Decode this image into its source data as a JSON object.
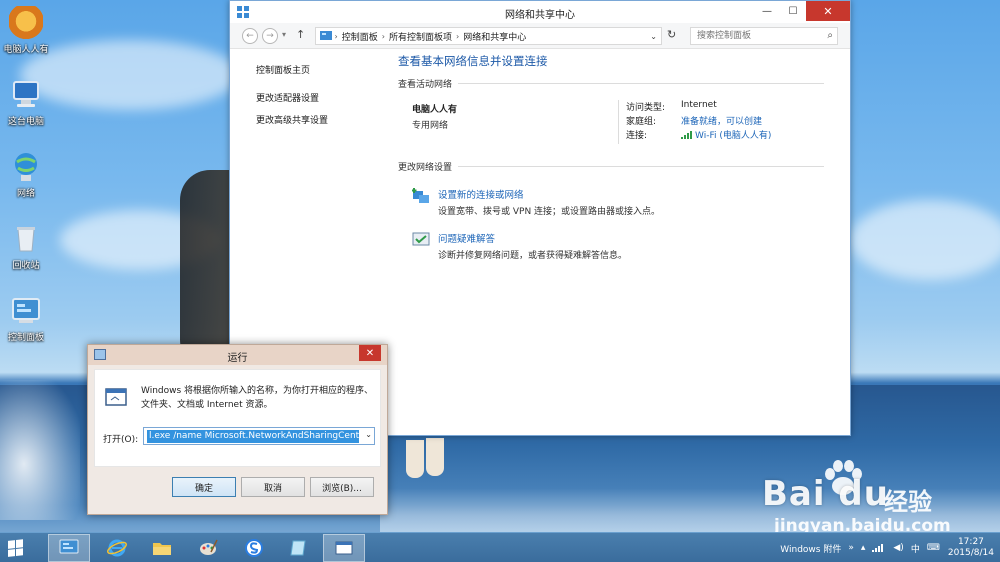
{
  "desktop": {
    "icons": [
      {
        "label": "电脑人人有"
      },
      {
        "label": "这台电脑"
      },
      {
        "label": "网络"
      },
      {
        "label": "回收站"
      },
      {
        "label": "控制面板"
      }
    ]
  },
  "watermark": {
    "brand": "Bai du",
    "brand_cn": "经验",
    "site": "jingyan.baidu.com"
  },
  "window": {
    "title": "网络和共享中心",
    "controls": {
      "minimize": "—",
      "maximize": "☐",
      "close": "✕"
    },
    "address": {
      "crumbs": [
        "控制面板",
        "所有控制面板项",
        "网络和共享中心"
      ]
    },
    "search": {
      "placeholder": "搜索控制面板"
    },
    "left_nav": [
      "控制面板主页",
      "更改适配器设置",
      "更改高级共享设置"
    ],
    "main": {
      "heading": "查看基本网络信息并设置连接",
      "active_networks_label": "查看活动网络",
      "network": {
        "name": "电脑人人有",
        "type": "专用网络",
        "access_type_label": "访问类型:",
        "access_type_value": "Internet",
        "homegroup_label": "家庭组:",
        "homegroup_value": "准备就绪，可以创建",
        "connection_label": "连接:",
        "connection_value": "Wi-Fi (电脑人人有)"
      },
      "change_settings_label": "更改网络设置",
      "tasks": [
        {
          "link": "设置新的连接或网络",
          "desc": "设置宽带、拨号或 VPN 连接；或设置路由器或接入点。"
        },
        {
          "link": "问题疑难解答",
          "desc": "诊断并修复网络问题，或者获得疑难解答信息。"
        }
      ]
    }
  },
  "run_dialog": {
    "title": "运行",
    "close": "✕",
    "description": "Windows 将根据你所输入的名称，为你打开相应的程序、文件夹、文档或 Internet 资源。",
    "open_label": "打开(O):",
    "open_value": "l.exe /name Microsoft.NetworkAndSharingCenter",
    "buttons": {
      "ok": "确定",
      "cancel": "取消",
      "browse": "浏览(B)..."
    }
  },
  "taskbar": {
    "tray": {
      "toolbar_label": "Windows 附件",
      "expand": "»",
      "ime": "中",
      "time": "17:27",
      "date": "2015/8/14"
    }
  },
  "colors": {
    "accent_link": "#1e66b8",
    "heading": "#1e5aa8",
    "close_button": "#c7372d",
    "taskbar": "#3a6c9c"
  }
}
